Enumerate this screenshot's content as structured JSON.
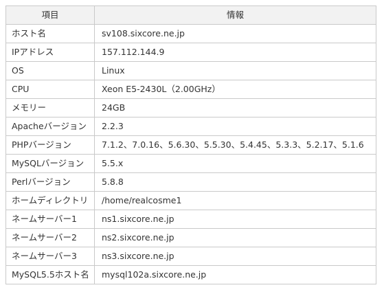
{
  "table": {
    "headers": [
      "項目",
      "情報"
    ],
    "rows": [
      {
        "label": "ホスト名",
        "value": "sv108.sixcore.ne.jp"
      },
      {
        "label": "IPアドレス",
        "value": "157.112.144.9"
      },
      {
        "label": "OS",
        "value": "Linux"
      },
      {
        "label": "CPU",
        "value": "Xeon E5-2430L（2.00GHz）"
      },
      {
        "label": "メモリー",
        "value": "24GB"
      },
      {
        "label": "Apacheバージョン",
        "value": "2.2.3"
      },
      {
        "label": "PHPバージョン",
        "value": "7.1.2、7.0.16、5.6.30、5.5.30、5.4.45、5.3.3、5.2.17、5.1.6"
      },
      {
        "label": "MySQLバージョン",
        "value": "5.5.x"
      },
      {
        "label": "Perlバージョン",
        "value": "5.8.8"
      },
      {
        "label": "ホームディレクトリ",
        "value": "/home/realcosme1"
      },
      {
        "label": "ネームサーバー1",
        "value": "ns1.sixcore.ne.jp"
      },
      {
        "label": "ネームサーバー2",
        "value": "ns2.sixcore.ne.jp"
      },
      {
        "label": "ネームサーバー3",
        "value": "ns3.sixcore.ne.jp"
      },
      {
        "label": "MySQL5.5ホスト名",
        "value": "mysql102a.sixcore.ne.jp"
      }
    ]
  },
  "colors": {
    "header_bg": "#f2f2f2",
    "border": "#c9c9c9",
    "text": "#333333"
  }
}
